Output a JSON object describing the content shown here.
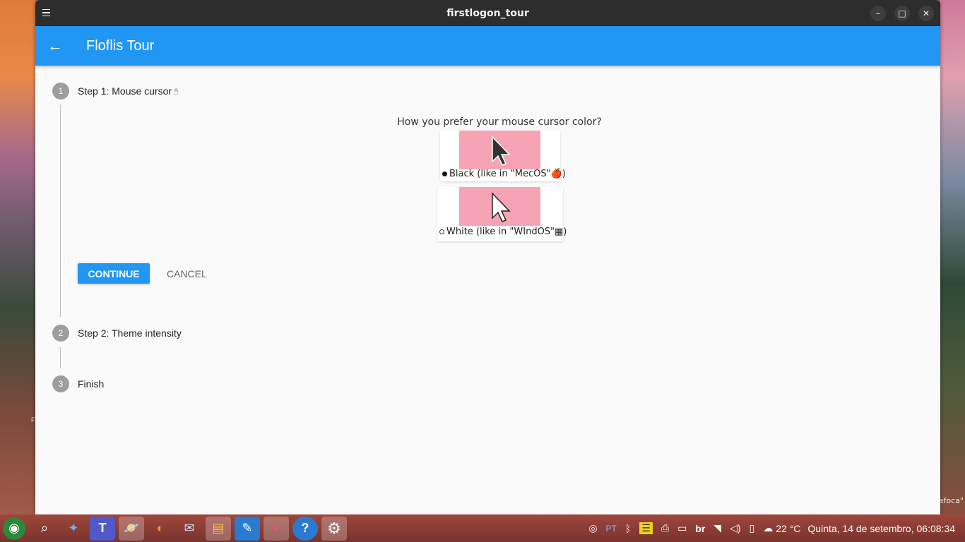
{
  "window": {
    "title": "firstlogon_tour",
    "minimize_glyph": "–",
    "maximize_glyph": "□",
    "close_glyph": "✕"
  },
  "appbar": {
    "back_glyph": "←",
    "title": "Floflis Tour"
  },
  "steps": [
    {
      "number": "1",
      "title": "Step 1: Mouse cursor",
      "extra": "🖱"
    },
    {
      "number": "2",
      "title": "Step 2: Theme intensity"
    },
    {
      "number": "3",
      "title": "Finish"
    }
  ],
  "question": "How you prefer your mouse cursor color?",
  "options": [
    {
      "label": "Black (like in \"MecOS\"🍎)",
      "selected": true,
      "cursor_color": "#333333"
    },
    {
      "label": "White (like in \"WIndOS\"▦)",
      "selected": false,
      "cursor_color": "#ffffff"
    }
  ],
  "buttons": {
    "continue": "CONTINUE",
    "cancel": "CANCEL"
  },
  "desktop": {
    "right_text": "afoca\"",
    "left_text": "F"
  },
  "taskbar": {
    "apps": [
      {
        "name": "launcher-icon",
        "glyph": "◉",
        "active": false
      },
      {
        "name": "search-icon",
        "glyph": "⌕",
        "active": false
      },
      {
        "name": "genie-icon",
        "glyph": "✦",
        "active": false
      },
      {
        "name": "teams-icon",
        "glyph": "T",
        "active": false
      },
      {
        "name": "planet-app-icon",
        "glyph": "🪐",
        "active": true
      },
      {
        "name": "firefox-icon",
        "glyph": "◐",
        "active": false
      },
      {
        "name": "mail-icon",
        "glyph": "✉",
        "active": false
      },
      {
        "name": "files-icon",
        "glyph": "▤",
        "active": true
      },
      {
        "name": "text-editor-icon",
        "glyph": "✎",
        "active": false
      },
      {
        "name": "media-app-icon",
        "glyph": "✧",
        "active": true
      },
      {
        "name": "help-icon",
        "glyph": "?",
        "active": false
      },
      {
        "name": "settings-icon",
        "glyph": "⚙",
        "active": true
      }
    ],
    "tray": {
      "camera": "◎",
      "keyboard_lang": "PT",
      "bluetooth": "ᛒ",
      "notes": "☰",
      "printer": "⎙",
      "display": "▭",
      "layout": "br",
      "wifi": "◥",
      "volume": "◁)",
      "battery": "▯",
      "weather": "☁",
      "temperature": "22 °C",
      "clock": "Quinta, 14 de setembro, 06:08:34"
    }
  },
  "colors": {
    "accent": "#2196f3",
    "titlebar": "#2d2d2d",
    "option_image_bg": "#f5a3b5"
  }
}
